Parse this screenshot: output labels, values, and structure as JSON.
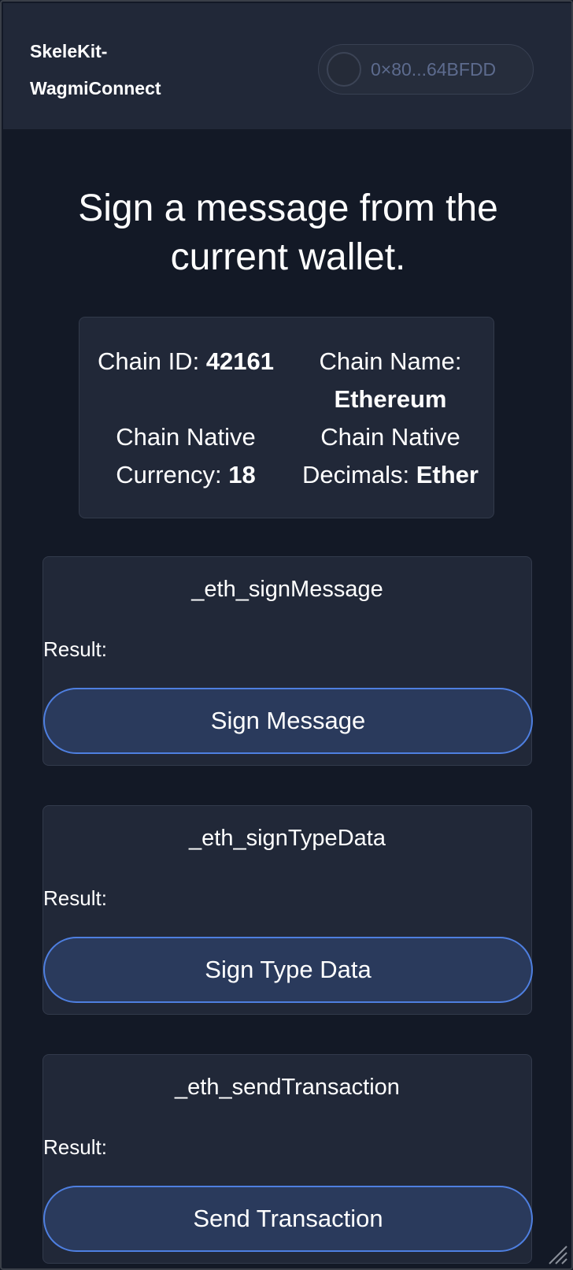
{
  "header": {
    "brand_line1": "SkeleKit-",
    "brand_line2": "WagmiConnect",
    "wallet_address": "0×80...64BFDD"
  },
  "main": {
    "title": "Sign a message from the current wallet."
  },
  "chain_info": {
    "chain_id_label": "Chain ID:",
    "chain_id_value": "42161",
    "chain_name_label": "Chain Name:",
    "chain_name_value": "Ethereum",
    "native_currency_label_1": "Chain Native",
    "native_currency_label_2": "Currency:",
    "native_currency_value": "18",
    "native_decimals_label_1": "Chain Native",
    "native_decimals_label_2": "Decimals:",
    "native_decimals_value": "Ether"
  },
  "methods": [
    {
      "title": "_eth_signMessage",
      "result_label": "Result:",
      "button_label": "Sign Message"
    },
    {
      "title": "_eth_signTypeData",
      "result_label": "Result:",
      "button_label": "Sign Type Data"
    },
    {
      "title": "_eth_sendTransaction",
      "result_label": "Result:",
      "button_label": "Send Transaction"
    }
  ],
  "colors": {
    "background": "#131926",
    "card": "#212838",
    "button_fill": "#2a3a5c",
    "button_border": "#4e7fe0",
    "wallet_text": "#5d6b8e"
  },
  "icons": {
    "wallet_avatar": "avatar-circle-icon",
    "resize": "resize-grip-icon"
  }
}
